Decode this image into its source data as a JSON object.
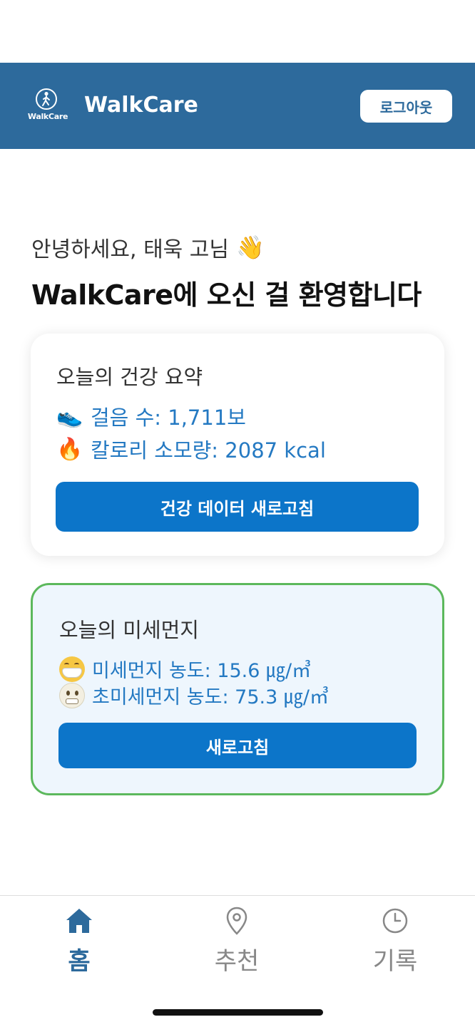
{
  "header": {
    "logo_text": "WalkCare",
    "app_title": "WalkCare",
    "logout_label": "로그아웃"
  },
  "greeting": {
    "text": "안녕하세요, 태욱 고님",
    "wave": "👋",
    "welcome": "WalkCare에 오신 걸 환영합니다"
  },
  "health_card": {
    "title": "오늘의 건강 요약",
    "steps_icon": "👟",
    "steps_text": "걸음 수: 1,711보",
    "calories_icon": "🔥",
    "calories_text": "칼로리 소모량: 2087 kcal",
    "refresh_label": "건강 데이터 새로고침"
  },
  "dust_card": {
    "title": "오늘의 미세먼지",
    "pm10_icon": "mask-face-icon",
    "pm10_text": "미세먼지 농도: 15.6 ㎍/㎥",
    "pm25_icon": "grimace-face-icon",
    "pm25_text": "초미세먼지 농도: 75.3 ㎍/㎥",
    "refresh_label": "새로고침"
  },
  "bottom_nav": {
    "items": [
      {
        "label": "홈",
        "icon": "home-icon",
        "active": true
      },
      {
        "label": "추천",
        "icon": "map-pin-icon",
        "active": false
      },
      {
        "label": "기록",
        "icon": "clock-icon",
        "active": false
      }
    ]
  },
  "colors": {
    "header_bg": "#2d6a9c",
    "primary_button": "#0c75c9",
    "stat_text": "#2479c2",
    "dust_border": "#5cb85c",
    "dust_bg": "#eef6fd",
    "nav_inactive": "#888888"
  }
}
